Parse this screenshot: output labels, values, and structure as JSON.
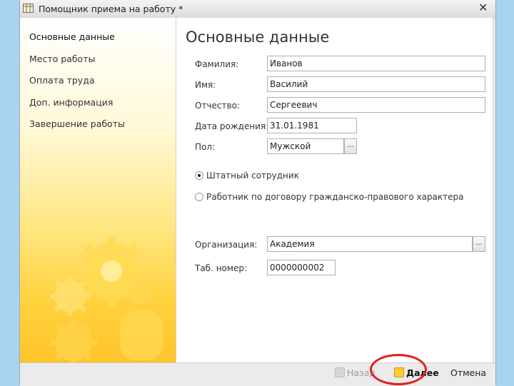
{
  "window": {
    "title": "Помощник приема на работу *",
    "close_symbol": "✕"
  },
  "sidebar": {
    "items": [
      {
        "label": "Основные данные",
        "active": true
      },
      {
        "label": "Место работы"
      },
      {
        "label": "Оплата труда"
      },
      {
        "label": "Доп. информация"
      },
      {
        "label": "Завершение работы"
      }
    ]
  },
  "content": {
    "heading": "Основные данные",
    "fields": {
      "last_name": {
        "label": "Фамилия:",
        "value": "Иванов"
      },
      "first_name": {
        "label": "Имя:",
        "value": "Василий"
      },
      "patronymic": {
        "label": "Отчество:",
        "value": "Сергеевич"
      },
      "birth_date": {
        "label": "Дата рождения:",
        "value": "31.01.1981"
      },
      "gender": {
        "label": "Пол:",
        "value": "Мужской",
        "button": "..."
      },
      "organization": {
        "label": "Организация:",
        "value": "Академия",
        "button": "..."
      },
      "tab_number": {
        "label": "Таб. номер:",
        "value": "0000000002"
      }
    },
    "employment_type": {
      "options": [
        {
          "label": "Штатный сотрудник",
          "selected": true
        },
        {
          "label": "Работник по договору гражданско-правового характера",
          "selected": false
        }
      ]
    }
  },
  "footer": {
    "back_label": "Назад",
    "next_label": "Далее",
    "cancel_label": "Отмена"
  },
  "colors": {
    "highlight_ring": "#e0201e",
    "sidebar_accent": "#ffc42a",
    "background": "#a9d3ee"
  }
}
